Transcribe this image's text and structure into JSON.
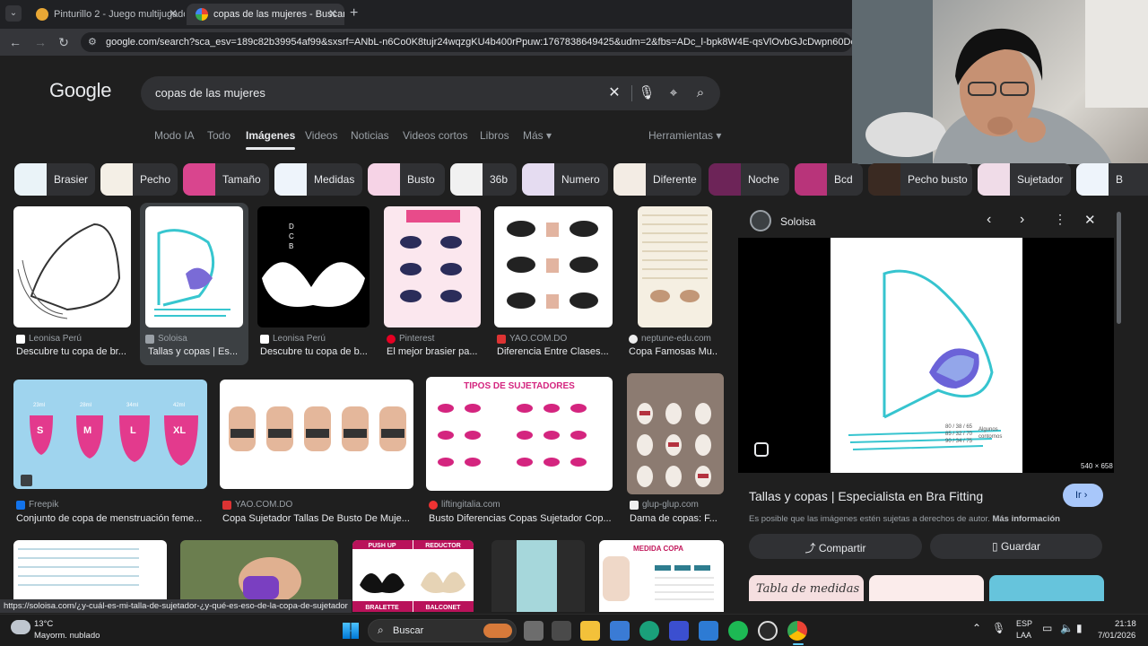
{
  "browser": {
    "tabs": [
      {
        "title": "Pinturillo 2 - Juego multijugado",
        "active": false
      },
      {
        "title": "copas de las mujeres - Buscar c",
        "active": true
      }
    ],
    "url": "google.com/search?sca_esv=189c82b39954af99&sxsrf=ANbL-n6Co0K8tujr24wqzgKU4b400rPpuw:1767838649425&udm=2&fbs=ADc_l-bpk8W4E-qsVlOvbGJcDwpn60DczFdcvPnu"
  },
  "google": {
    "logo": "Google",
    "query": "copas de las mujeres",
    "tabs": [
      "Modo IA",
      "Todo",
      "Imágenes",
      "Videos",
      "Noticias",
      "Videos cortos",
      "Libros",
      "Más ▾"
    ],
    "tools": "Herramientas ▾",
    "chips": [
      "Brasier",
      "Pecho",
      "Tamaño",
      "Medidas",
      "Busto",
      "36b",
      "Numero",
      "Diferente",
      "Noche",
      "Bcd",
      "Pecho busto",
      "Sujetador",
      "B"
    ]
  },
  "results_row1": [
    {
      "source": "Leonisa Perú",
      "title": "Descubre tu copa de br..."
    },
    {
      "source": "Soloisa",
      "title": "Tallas y copas | Es..."
    },
    {
      "source": "Leonisa Perú",
      "title": "Descubre tu copa de b..."
    },
    {
      "source": "Pinterest",
      "title": "El mejor brasier pa..."
    },
    {
      "source": "YAO.COM.DO",
      "title": "Diferencia Entre Clases..."
    },
    {
      "source": "neptune-edu.com",
      "title": "Copa Famosas Mu..."
    }
  ],
  "results_row2": [
    {
      "source": "Freepik",
      "title": "Conjunto de copa de menstruación feme..."
    },
    {
      "source": "YAO.COM.DO",
      "title": "Copa Sujetador Tallas De Busto De Muje..."
    },
    {
      "source": "liftingitalia.com",
      "title": "Busto Diferencias Copas Sujetador Cop..."
    },
    {
      "source": "glup-glup.com",
      "title": "Dama de copas: F..."
    }
  ],
  "thumb_text": {
    "cups": [
      "S",
      "M",
      "L",
      "XL"
    ],
    "cup_sizes": [
      "23ml",
      "28ml",
      "34ml",
      "42ml"
    ],
    "tipos": "TIPOS DE SUJETADORES",
    "push_up": "PUSH UP",
    "reductor": "REDUCTOR",
    "bralette": "BRALETTE",
    "balconet": "BALCONET",
    "medida_copa": "MEDIDA COPA",
    "dcb": [
      "D",
      "C",
      "B"
    ]
  },
  "panel": {
    "source": "Soloisa",
    "dimensions": "540 × 658",
    "title": "Tallas y copas | Especialista en Bra Fitting",
    "go": "Ir",
    "notice": "Es posible que las imágenes estén sujetas a derechos de autor.",
    "more_info": "Más información",
    "share": "Compartir",
    "save": "Guardar",
    "tabla": "Tabla de medidas"
  },
  "status_url": "https://soloisa.com/¿y-cuál-es-mi-talla-de-sujetador-¿y-qué-es-eso-de-la-copa-de-sujetador",
  "taskbar": {
    "weather_temp": "13°C",
    "weather_desc": "Mayorm. nublado",
    "search": "Buscar",
    "lang1": "ESP",
    "lang2": "LAA",
    "time": "21:18",
    "date": "7/01/2026"
  }
}
